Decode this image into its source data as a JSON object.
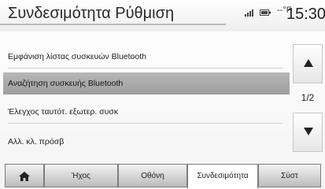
{
  "header": {
    "title": "Συνδεσιμότητα Ρύθμιση",
    "temperature": "--°F",
    "clock": "15:30",
    "signal_icon": "signal-bars-icon",
    "battery_icon": "battery-icon"
  },
  "list": {
    "items": [
      {
        "label": "Εμφάνιση λίστας συσκευών Bluetooth",
        "selected": false
      },
      {
        "label": "Αναζήτηση συσκευής Bluetooth",
        "selected": true
      },
      {
        "label": "Έλεγχος ταυτότ. εξωτερ. συσκ",
        "selected": false
      },
      {
        "label": "Αλλ. κλ. πρόσβ",
        "selected": false
      }
    ]
  },
  "pager": {
    "indicator": "1/2",
    "up_icon": "arrow-up-icon",
    "down_icon": "arrow-down-icon"
  },
  "tabs": [
    {
      "label": "",
      "icon": "home-icon"
    },
    {
      "label": "Ήχος"
    },
    {
      "label": "Οθόνη"
    },
    {
      "label": "Συνδεσιμότητα",
      "active": true
    },
    {
      "label": "Σύστ"
    }
  ],
  "colors": {
    "selected_row": "#a8a8a8",
    "text": "#202020"
  }
}
